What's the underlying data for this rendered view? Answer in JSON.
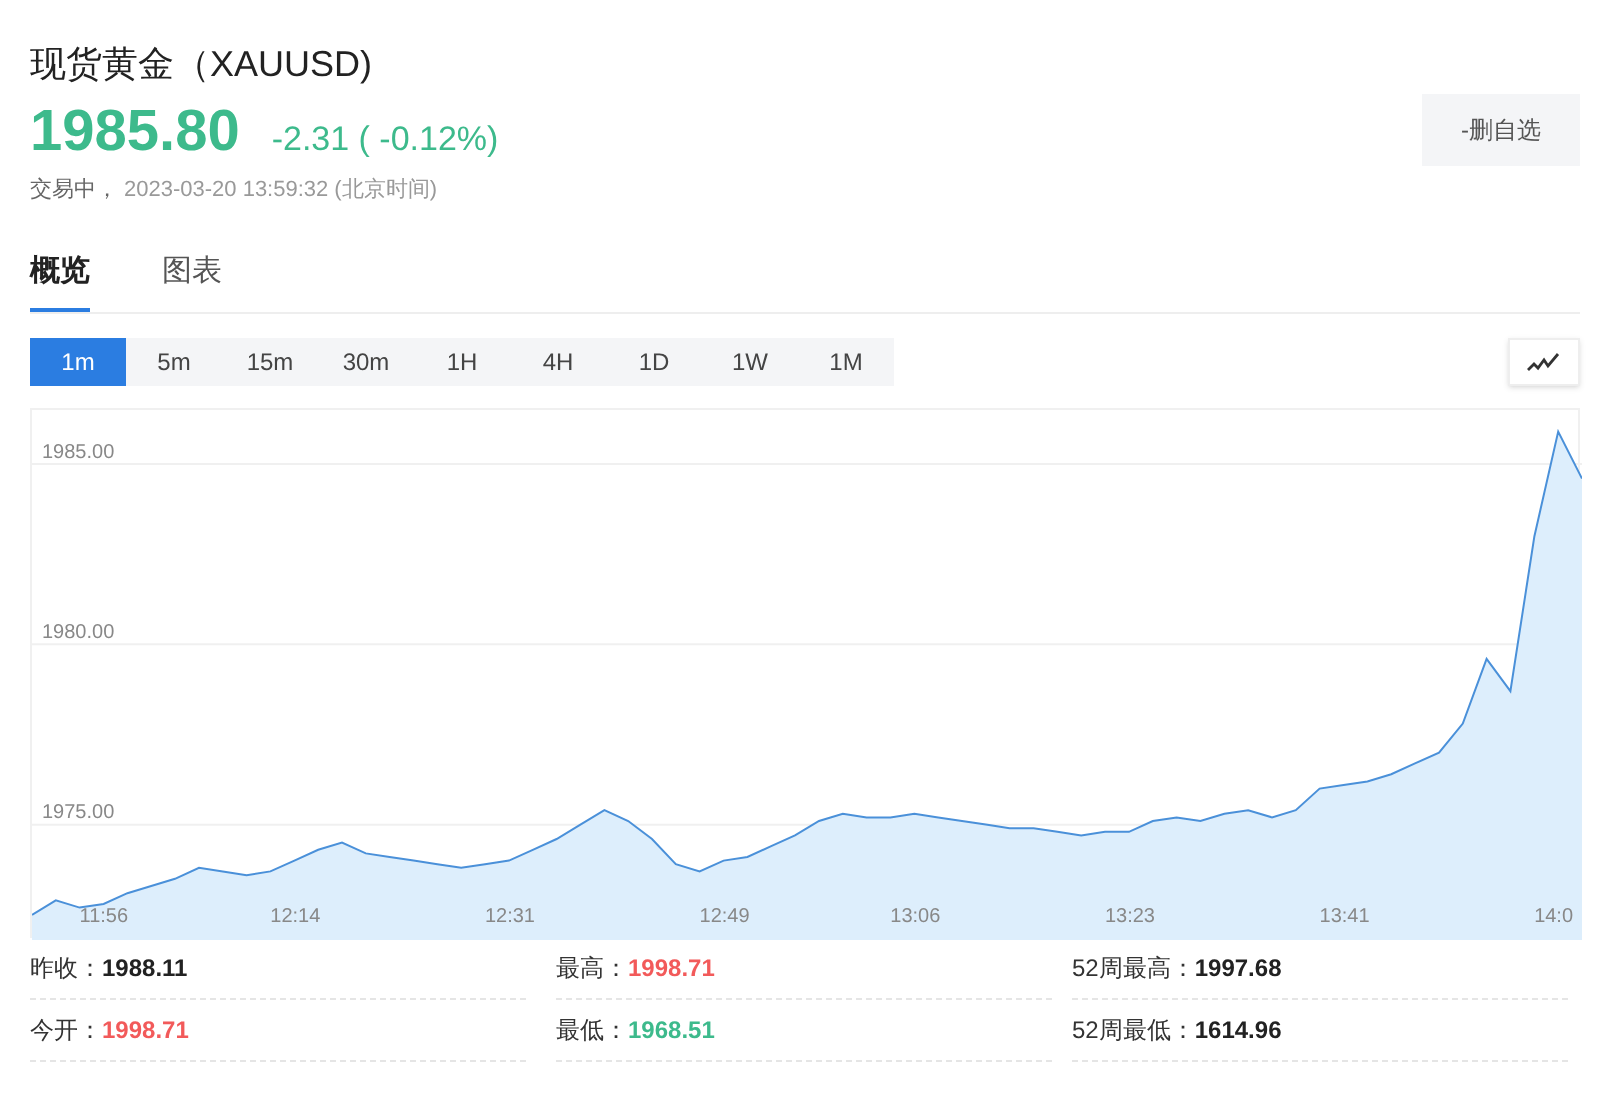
{
  "header": {
    "title": "现货黄金（XAUUSD)",
    "price": "1985.80",
    "change": "-2.31 ( -0.12%)",
    "color": "#3dba8c",
    "status": "交易中，",
    "timestamp": "2023-03-20 13:59:32",
    "timezone": "(北京时间)",
    "watch_button": "-删自选"
  },
  "tabs": [
    {
      "label": "概览",
      "selected": true
    },
    {
      "label": "图表",
      "selected": false
    }
  ],
  "periods": [
    {
      "label": "1m",
      "selected": true
    },
    {
      "label": "5m",
      "selected": false
    },
    {
      "label": "15m",
      "selected": false
    },
    {
      "label": "30m",
      "selected": false
    },
    {
      "label": "1H",
      "selected": false
    },
    {
      "label": "4H",
      "selected": false
    },
    {
      "label": "1D",
      "selected": false
    },
    {
      "label": "1W",
      "selected": false
    },
    {
      "label": "1M",
      "selected": false
    }
  ],
  "chart_data": {
    "type": "area",
    "grid": true,
    "ylim": [
      1971.8,
      1986.5
    ],
    "yticks": [
      {
        "value": 1975,
        "label": "1975.00"
      },
      {
        "value": 1980,
        "label": "1980.00"
      },
      {
        "value": 1985,
        "label": "1985.00"
      }
    ],
    "categories": [
      null,
      null,
      null,
      "11:56",
      null,
      null,
      null,
      null,
      null,
      null,
      null,
      "12:14",
      null,
      null,
      null,
      null,
      null,
      null,
      null,
      null,
      "12:31",
      null,
      null,
      null,
      null,
      null,
      null,
      null,
      null,
      "12:49",
      null,
      null,
      null,
      null,
      null,
      null,
      null,
      "13:06",
      null,
      null,
      null,
      null,
      null,
      null,
      null,
      null,
      "13:23",
      null,
      null,
      null,
      null,
      null,
      null,
      null,
      null,
      "13:41",
      null,
      null,
      null,
      null,
      null,
      null,
      null,
      null,
      "14:0",
      null
    ],
    "series": [
      {
        "color": "#4a90d9",
        "values": [
          1972.5,
          1972.9,
          1972.7,
          1972.8,
          1973.1,
          1973.3,
          1973.5,
          1973.8,
          1973.7,
          1973.6,
          1973.7,
          1974.0,
          1974.3,
          1974.5,
          1974.2,
          1974.1,
          1974.0,
          1973.9,
          1973.8,
          1973.9,
          1974.0,
          1974.3,
          1974.6,
          1975.0,
          1975.4,
          1975.1,
          1974.6,
          1973.9,
          1973.7,
          1974.0,
          1974.1,
          1974.4,
          1974.7,
          1975.1,
          1975.3,
          1975.2,
          1975.2,
          1975.3,
          1975.2,
          1975.1,
          1975.0,
          1974.9,
          1974.9,
          1974.8,
          1974.7,
          1974.8,
          1974.8,
          1975.1,
          1975.2,
          1975.1,
          1975.3,
          1975.4,
          1975.2,
          1975.4,
          1976.0,
          1976.1,
          1976.2,
          1976.4,
          1976.7,
          1977.0,
          1977.8,
          1979.6,
          1978.7,
          1983.0,
          1985.9,
          1984.6
        ]
      }
    ]
  },
  "stats": [
    {
      "label": "昨收：",
      "value": "1988.11",
      "color": "#222222"
    },
    {
      "label": "最高：",
      "value": "1998.71",
      "color": "#f25a5a"
    },
    {
      "label": "52周最高：",
      "value": "1997.68",
      "color": "#222222"
    },
    {
      "label": "今开：",
      "value": "1998.71",
      "color": "#f25a5a"
    },
    {
      "label": "最低：",
      "value": "1968.51",
      "color": "#3dba8c"
    },
    {
      "label": "52周最低：",
      "value": "1614.96",
      "color": "#222222"
    }
  ]
}
